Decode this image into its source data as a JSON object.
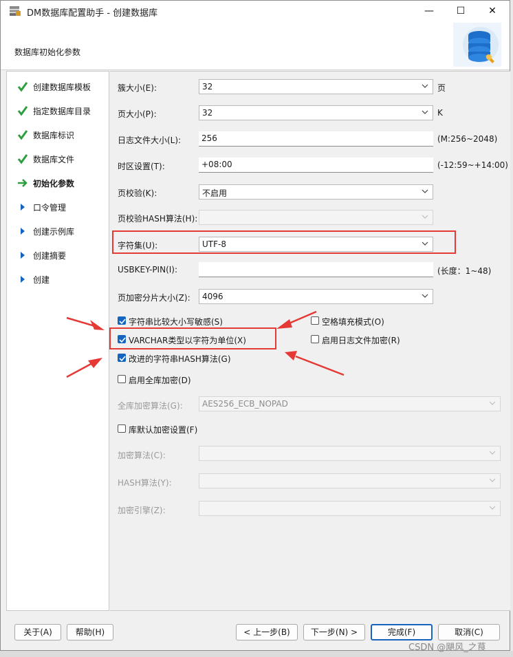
{
  "window": {
    "title": "DM数据库配置助手 - 创建数据库",
    "minimize": "—",
    "maximize": "☐",
    "close": "✕"
  },
  "header": {
    "title": "数据库初始化参数"
  },
  "sidebar": {
    "items": [
      {
        "label": "创建数据库模板",
        "state": "done"
      },
      {
        "label": "指定数据库目录",
        "state": "done"
      },
      {
        "label": "数据库标识",
        "state": "done"
      },
      {
        "label": "数据库文件",
        "state": "done"
      },
      {
        "label": "初始化参数",
        "state": "active"
      },
      {
        "label": "口令管理",
        "state": "pending"
      },
      {
        "label": "创建示例库",
        "state": "pending"
      },
      {
        "label": "创建摘要",
        "state": "pending"
      },
      {
        "label": "创建",
        "state": "pending"
      }
    ]
  },
  "form": {
    "extent_size": {
      "label": "簇大小(E):",
      "value": "32",
      "suffix": "页"
    },
    "page_size": {
      "label": "页大小(P):",
      "value": "32",
      "suffix": "K"
    },
    "log_size": {
      "label": "日志文件大小(L):",
      "value": "256",
      "suffix": "(M:256~2048)"
    },
    "timezone": {
      "label": "时区设置(T):",
      "value": "+08:00",
      "suffix": "(-12:59~+14:00)"
    },
    "page_check": {
      "label": "页校验(K):",
      "value": "不启用"
    },
    "page_hash": {
      "label": "页校验HASH算法(H):",
      "value": ""
    },
    "charset": {
      "label": "字符集(U):",
      "value": "UTF-8"
    },
    "usbkey": {
      "label": "USBKEY-PIN(I):",
      "value": "",
      "suffix": "(长度：1~48)"
    },
    "page_enc_slice": {
      "label": "页加密分片大小(Z):",
      "value": "4096"
    },
    "case_sensitive": {
      "label": "字符串比较大小写敏感(S)",
      "checked": true
    },
    "blank_pad": {
      "label": "空格填充模式(O)",
      "checked": false
    },
    "varchar_char": {
      "label": "VARCHAR类型以字符为单位(X)",
      "checked": true
    },
    "log_encrypt": {
      "label": "启用日志文件加密(R)",
      "checked": false
    },
    "improved_hash": {
      "label": "改进的字符串HASH算法(G)",
      "checked": true
    },
    "full_encrypt": {
      "label": "启用全库加密(D)",
      "checked": false
    },
    "full_enc_algo": {
      "label": "全库加密算法(G):",
      "value": "AES256_ECB_NOPAD"
    },
    "default_enc": {
      "label": "库默认加密设置(F)",
      "checked": false
    },
    "enc_algo": {
      "label": "加密算法(C):",
      "value": ""
    },
    "hash_algo": {
      "label": "HASH算法(Y):",
      "value": ""
    },
    "enc_engine": {
      "label": "加密引擎(Z):",
      "value": ""
    }
  },
  "footer": {
    "about": "关于(A)",
    "help": "帮助(H)",
    "prev": "< 上一步(B)",
    "next": "下一步(N) >",
    "finish": "完成(F)",
    "cancel": "取消(C)"
  },
  "watermark": "CSDN @飓风_之茛",
  "colors": {
    "accent": "#1565c0",
    "check_green": "#2e9e3e",
    "annotation_red": "#e53935"
  }
}
